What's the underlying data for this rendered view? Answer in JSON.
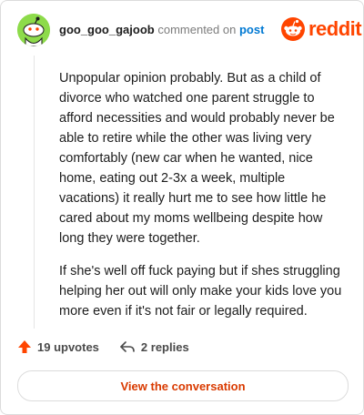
{
  "comment": {
    "username": "goo_goo_gajoob",
    "action_text": "commented on",
    "link_text": "post",
    "body": [
      "Unpopular opinion probably. But as a child of divorce who watched one parent struggle to afford necessities and would probably never be able to retire while the other was living very comfortably (new car when he wanted, nice home, eating out 2-3x a week, multiple vacations) it really hurt me to see how little he cared about my moms wellbeing despite how long they were together.",
      "If she's well off fuck paying but if shes struggling helping her out will only make your kids love you more even if it's not fair or legally required."
    ]
  },
  "brand": {
    "name": "reddit",
    "color": "#ff4500"
  },
  "footer": {
    "upvotes_label": "19 upvotes",
    "replies_label": "2 replies",
    "upvote_icon": "upvote-arrow-icon",
    "reply_icon": "reply-arrow-icon"
  },
  "cta": {
    "label": "View the conversation"
  },
  "colors": {
    "avatar_bg": "#8ddb4a",
    "link": "#0079d3",
    "upvote": "#ff4500",
    "cta_text": "#d93a00"
  }
}
